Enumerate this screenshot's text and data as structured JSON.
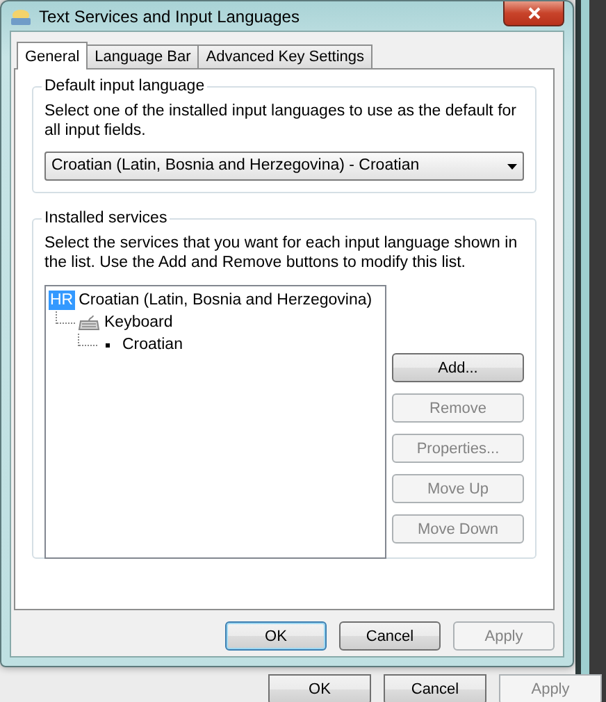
{
  "window": {
    "title": "Text Services and Input Languages"
  },
  "tabs": [
    {
      "label": "General",
      "selected": true
    },
    {
      "label": "Language Bar",
      "selected": false
    },
    {
      "label": "Advanced Key Settings",
      "selected": false
    }
  ],
  "default_input_language": {
    "heading": "Default input language",
    "description": "Select one of the installed input languages to use as the default for all input fields.",
    "value": "Croatian (Latin, Bosnia and Herzegovina) - Croatian"
  },
  "installed_services": {
    "heading": "Installed services",
    "description": "Select the services that you want for each input language shown in the list. Use the Add and Remove buttons to modify this list.",
    "tree": [
      {
        "kind": "language",
        "badge": "HR",
        "label": "Croatian (Latin, Bosnia and Herzegovina)",
        "selected": true,
        "children": [
          {
            "kind": "category",
            "label": "Keyboard",
            "selected": false,
            "children": [
              {
                "kind": "service",
                "label": "Croatian",
                "selected": false
              }
            ]
          }
        ]
      }
    ]
  },
  "side_buttons": [
    {
      "label": "Add...",
      "disabled": false
    },
    {
      "label": "Remove",
      "disabled": true
    },
    {
      "label": "Properties...",
      "disabled": true
    },
    {
      "label": "Move Up",
      "disabled": true
    },
    {
      "label": "Move Down",
      "disabled": true
    }
  ],
  "buttons": [
    {
      "label": "OK",
      "default": true,
      "disabled": false
    },
    {
      "label": "Cancel",
      "default": false,
      "disabled": false
    },
    {
      "label": "Apply",
      "default": false,
      "disabled": true
    }
  ],
  "background_buttons": [
    {
      "label": "OK",
      "disabled": false
    },
    {
      "label": "Cancel",
      "disabled": false
    },
    {
      "label": "Apply",
      "disabled": true
    }
  ]
}
